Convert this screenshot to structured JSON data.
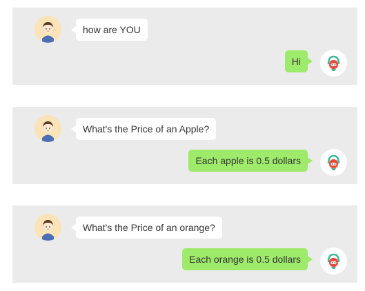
{
  "conversations": [
    {
      "user_message": "how are YOU",
      "bot_reply": "Hi"
    },
    {
      "user_message": "What's the Price of an Apple?",
      "bot_reply": "Each apple is 0.5 dollars"
    },
    {
      "user_message": "What's the Price of an orange?",
      "bot_reply": "Each orange is 0.5 dollars"
    }
  ],
  "colors": {
    "panel_bg": "#ebebeb",
    "user_bubble": "#ffffff",
    "bot_bubble": "#9eea6a",
    "user_avatar_bg": "#fbe3b8",
    "bot_avatar_bg": "#ffffff",
    "bot_accent": "#e84b3c",
    "bot_ring": "#3db89a"
  },
  "icons": {
    "user_avatar": "boy-avatar-icon",
    "bot_avatar": "robot-avatar-icon"
  }
}
